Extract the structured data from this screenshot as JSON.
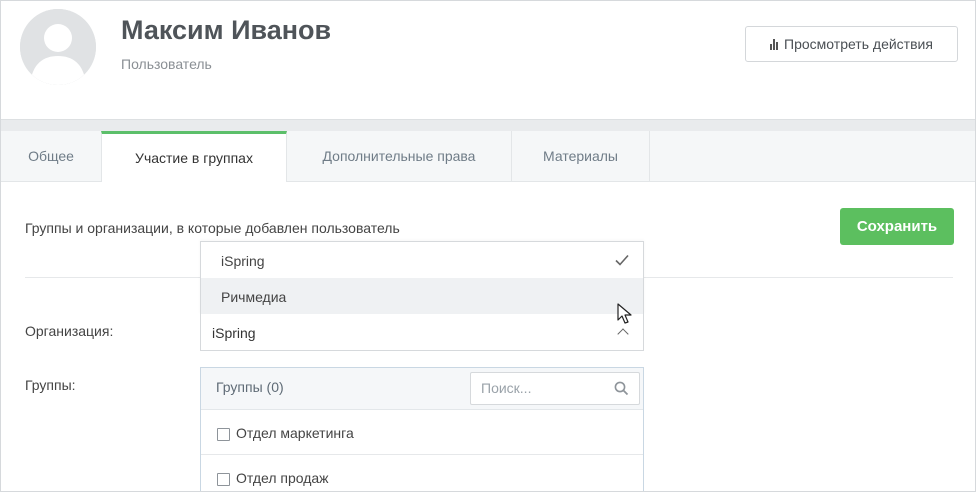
{
  "header": {
    "user_name": "Максим Иванов",
    "user_role": "Пользователь",
    "view_actions_label": "Просмотреть действия"
  },
  "tabs": [
    {
      "label": "Общее",
      "active": false
    },
    {
      "label": "Участие в группах",
      "active": true
    },
    {
      "label": "Дополнительные права",
      "active": false
    },
    {
      "label": "Материалы",
      "active": false
    }
  ],
  "content": {
    "section_title": "Группы и организации, в которые добавлен пользователь",
    "save_label": "Сохранить",
    "organization_label": "Организация:",
    "groups_label": "Группы:"
  },
  "organization_select": {
    "value": "iSpring",
    "options": [
      {
        "label": "iSpring",
        "selected": true
      },
      {
        "label": "Ричмедиа",
        "selected": false,
        "hovered": true
      }
    ]
  },
  "groups_panel": {
    "count_label": "Группы (0)",
    "search_placeholder": "Поиск...",
    "items": [
      {
        "label": "Отдел маркетинга",
        "checked": false
      },
      {
        "label": "Отдел продаж",
        "checked": false
      }
    ]
  },
  "colors": {
    "accent_green": "#5cbf5f",
    "tab_active_border": "#5cbf6a"
  },
  "icons": {
    "actions": "bar-chart-icon",
    "selected": "check-icon",
    "collapse": "chevron-up-icon",
    "search": "search-icon"
  }
}
